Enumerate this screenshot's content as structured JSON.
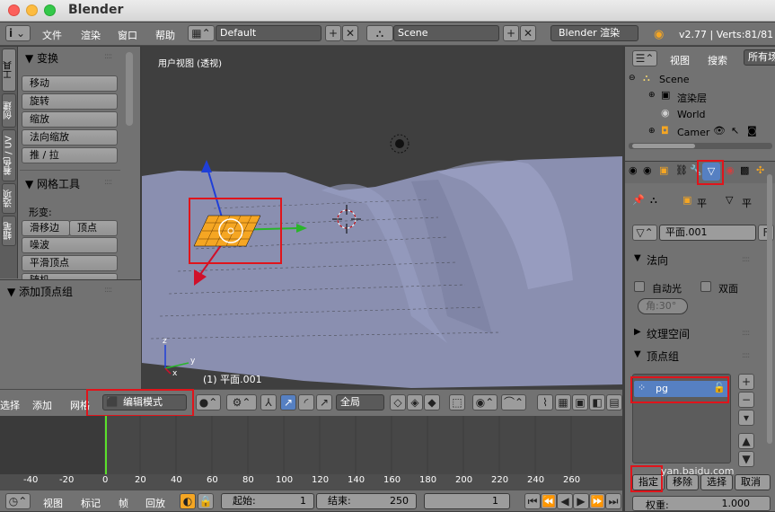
{
  "window": {
    "title": "Blender"
  },
  "topbar": {
    "info_icon": "i",
    "menus": [
      "文件",
      "渲染",
      "窗口",
      "帮助"
    ],
    "layout": "Default",
    "scene": "Scene",
    "engine": "Blender 渲染",
    "version_stats": "v2.77 | Verts:81/81 |"
  },
  "toolshelf": {
    "tabs": [
      "工具",
      "创建",
      "着色 / UV",
      "选项",
      "蜡笔"
    ],
    "transform_header": "▼ 变换",
    "transform_buttons": [
      "移动",
      "旋转",
      "缩放",
      "法向缩放",
      "推 / 拉"
    ],
    "mesh_header": "▼ 网格工具",
    "deform_label": "形变:",
    "slide_edge": "滑移边",
    "vertex": "顶点",
    "noise": "噪波",
    "smooth_vertex": "平滑顶点",
    "truncated": "随机",
    "add_vgroup_header": "▼ 添加顶点组"
  },
  "viewport": {
    "view_label": "用户视图 (透视)",
    "object_label": "(1) 平面.001"
  },
  "viewport_header": {
    "select": "选择",
    "add": "添加",
    "mesh": "网格",
    "mode": "编辑模式",
    "pivot_global": "全局"
  },
  "timeline": {
    "ticks": [
      "-40",
      "-20",
      "0",
      "20",
      "40",
      "60",
      "80",
      "100",
      "120",
      "140",
      "160",
      "180",
      "200",
      "220",
      "240",
      "260"
    ],
    "menus": [
      "视图",
      "标记",
      "帧",
      "回放"
    ],
    "start_label": "起始:",
    "start_value": "1",
    "end_label": "结束:",
    "end_value": "250",
    "current": "1"
  },
  "outliner": {
    "view": "视图",
    "search": "搜索",
    "all_scenes": "所有场",
    "items": [
      "Scene",
      "渲染层",
      "World",
      "Camer"
    ]
  },
  "properties": {
    "crumb_plane": "平",
    "crumb_data": "平",
    "mesh_name": "平面.001",
    "fake_user": "F",
    "normals_header": "法向",
    "auto_smooth": "自动光",
    "double_sided": "双面",
    "angle": "角:30°",
    "texture_space_header": "纹理空间",
    "vgroups_header": "顶点组",
    "vgroup_item": "pg",
    "assign": "指定",
    "remove": "移除",
    "select": "选择",
    "deselect": "取消",
    "weight_label": "权重:",
    "weight_value": "1.000"
  },
  "watermark": "yan.baidu.com",
  "colors": {
    "highlight": "#e0141b",
    "selected": "#5680c2",
    "mesh_select": "#f5a623"
  }
}
